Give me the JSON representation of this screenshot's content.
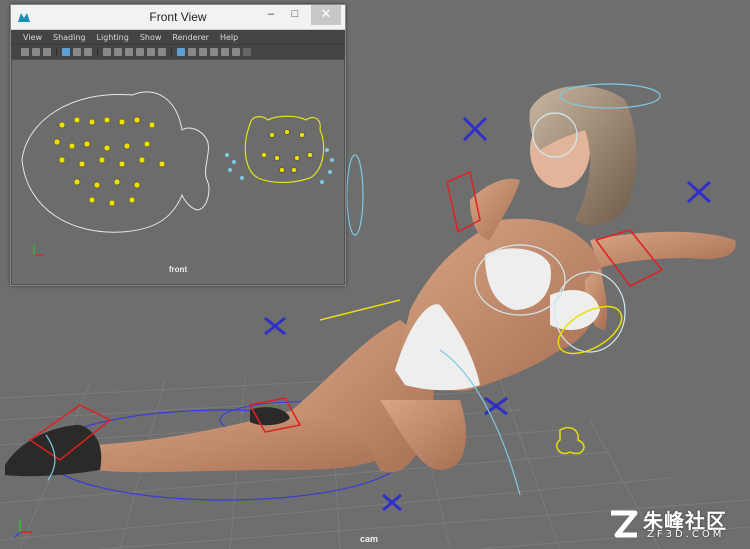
{
  "window": {
    "title": "Front View",
    "minimize": "–",
    "maximize": "□",
    "close": "✕",
    "app_icon": "maya-icon"
  },
  "menu": [
    "View",
    "Shading",
    "Lighting",
    "Show",
    "Renderer",
    "Help"
  ],
  "front_view_label": "front",
  "main_viewport_label": "cam",
  "watermark": {
    "text": "朱峰社区",
    "sub": "ZF3D.COM"
  },
  "colors": {
    "viewport_bg": "#6e6e6e",
    "grid": "#808080",
    "control_blue": "#3b3bd6",
    "control_red": "#e02020",
    "control_cyan": "#7ec9e0",
    "control_yellow": "#e8e000"
  }
}
